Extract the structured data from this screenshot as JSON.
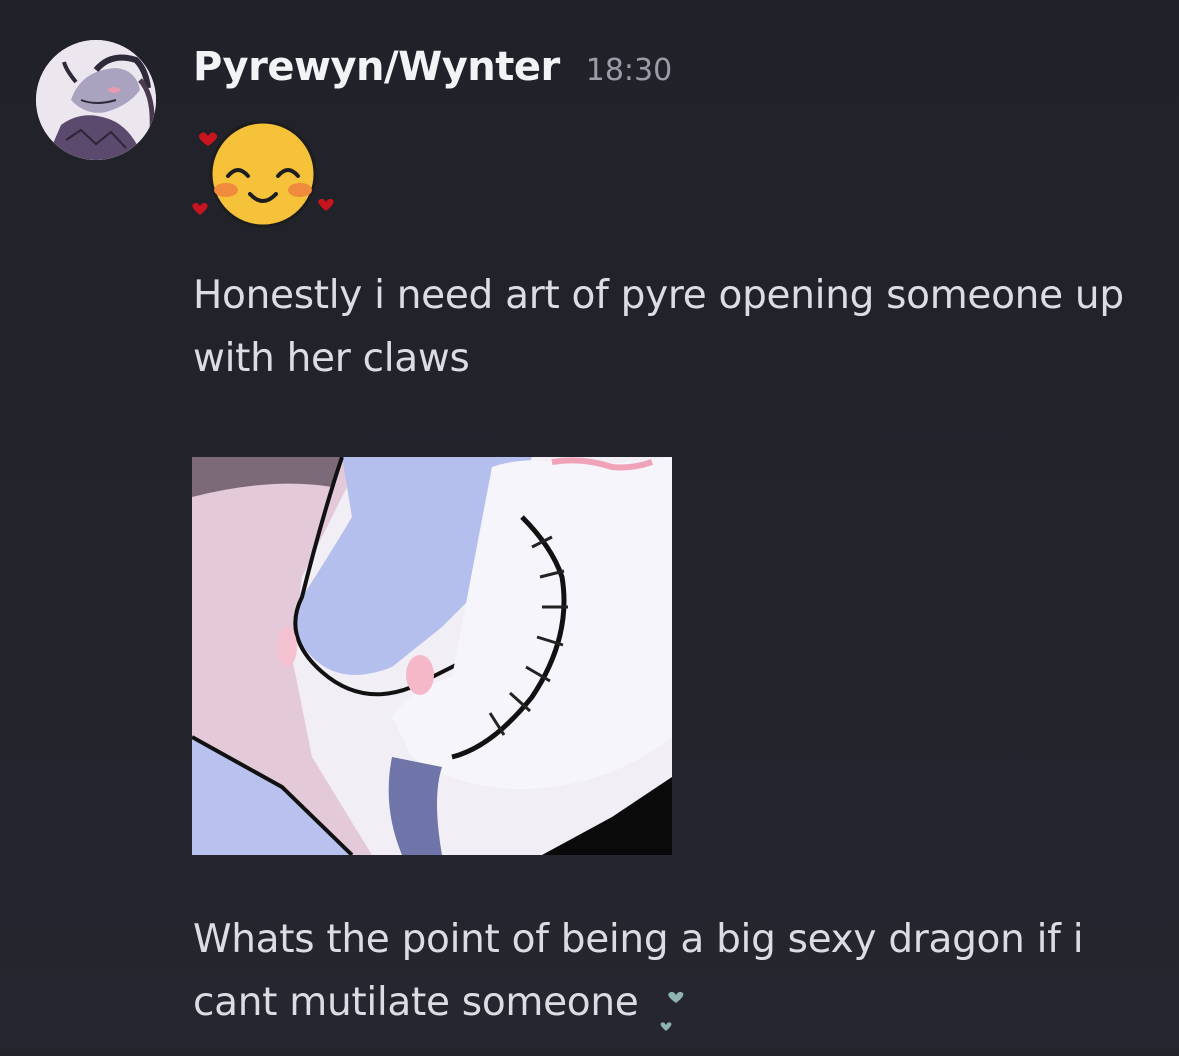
{
  "message": {
    "author": "Pyrewyn/Wynter",
    "timestamp": "18:30",
    "reaction_emoji": "blushing-smile-hearts-emoji",
    "lines": [
      "Honestly i need art of pyre opening someone up with her claws",
      "Whats the point of being a big sexy dragon if i cant mutilate someone"
    ],
    "trailing_emoji": "floating-hearts-emoji"
  },
  "colors": {
    "background": "#23232c",
    "author": "#f2f3f5",
    "text": "#dcdde3",
    "timestamp": "#9a9ca6"
  }
}
